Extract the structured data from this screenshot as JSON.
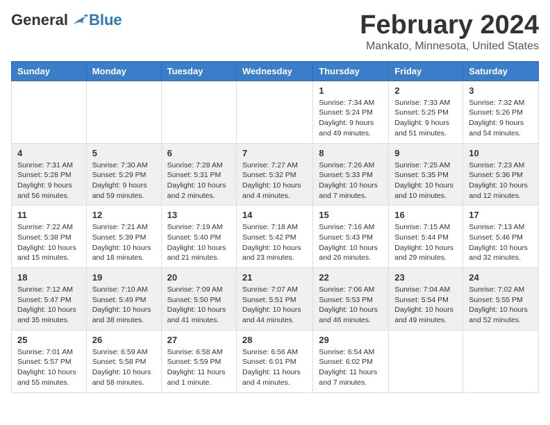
{
  "header": {
    "logo_general": "General",
    "logo_blue": "Blue",
    "month_title": "February 2024",
    "location": "Mankato, Minnesota, United States"
  },
  "weekdays": [
    "Sunday",
    "Monday",
    "Tuesday",
    "Wednesday",
    "Thursday",
    "Friday",
    "Saturday"
  ],
  "weeks": [
    [
      {
        "day": "",
        "info": ""
      },
      {
        "day": "",
        "info": ""
      },
      {
        "day": "",
        "info": ""
      },
      {
        "day": "",
        "info": ""
      },
      {
        "day": "1",
        "info": "Sunrise: 7:34 AM\nSunset: 5:24 PM\nDaylight: 9 hours\nand 49 minutes."
      },
      {
        "day": "2",
        "info": "Sunrise: 7:33 AM\nSunset: 5:25 PM\nDaylight: 9 hours\nand 51 minutes."
      },
      {
        "day": "3",
        "info": "Sunrise: 7:32 AM\nSunset: 5:26 PM\nDaylight: 9 hours\nand 54 minutes."
      }
    ],
    [
      {
        "day": "4",
        "info": "Sunrise: 7:31 AM\nSunset: 5:28 PM\nDaylight: 9 hours\nand 56 minutes."
      },
      {
        "day": "5",
        "info": "Sunrise: 7:30 AM\nSunset: 5:29 PM\nDaylight: 9 hours\nand 59 minutes."
      },
      {
        "day": "6",
        "info": "Sunrise: 7:28 AM\nSunset: 5:31 PM\nDaylight: 10 hours\nand 2 minutes."
      },
      {
        "day": "7",
        "info": "Sunrise: 7:27 AM\nSunset: 5:32 PM\nDaylight: 10 hours\nand 4 minutes."
      },
      {
        "day": "8",
        "info": "Sunrise: 7:26 AM\nSunset: 5:33 PM\nDaylight: 10 hours\nand 7 minutes."
      },
      {
        "day": "9",
        "info": "Sunrise: 7:25 AM\nSunset: 5:35 PM\nDaylight: 10 hours\nand 10 minutes."
      },
      {
        "day": "10",
        "info": "Sunrise: 7:23 AM\nSunset: 5:36 PM\nDaylight: 10 hours\nand 12 minutes."
      }
    ],
    [
      {
        "day": "11",
        "info": "Sunrise: 7:22 AM\nSunset: 5:38 PM\nDaylight: 10 hours\nand 15 minutes."
      },
      {
        "day": "12",
        "info": "Sunrise: 7:21 AM\nSunset: 5:39 PM\nDaylight: 10 hours\nand 18 minutes."
      },
      {
        "day": "13",
        "info": "Sunrise: 7:19 AM\nSunset: 5:40 PM\nDaylight: 10 hours\nand 21 minutes."
      },
      {
        "day": "14",
        "info": "Sunrise: 7:18 AM\nSunset: 5:42 PM\nDaylight: 10 hours\nand 23 minutes."
      },
      {
        "day": "15",
        "info": "Sunrise: 7:16 AM\nSunset: 5:43 PM\nDaylight: 10 hours\nand 26 minutes."
      },
      {
        "day": "16",
        "info": "Sunrise: 7:15 AM\nSunset: 5:44 PM\nDaylight: 10 hours\nand 29 minutes."
      },
      {
        "day": "17",
        "info": "Sunrise: 7:13 AM\nSunset: 5:46 PM\nDaylight: 10 hours\nand 32 minutes."
      }
    ],
    [
      {
        "day": "18",
        "info": "Sunrise: 7:12 AM\nSunset: 5:47 PM\nDaylight: 10 hours\nand 35 minutes."
      },
      {
        "day": "19",
        "info": "Sunrise: 7:10 AM\nSunset: 5:49 PM\nDaylight: 10 hours\nand 38 minutes."
      },
      {
        "day": "20",
        "info": "Sunrise: 7:09 AM\nSunset: 5:50 PM\nDaylight: 10 hours\nand 41 minutes."
      },
      {
        "day": "21",
        "info": "Sunrise: 7:07 AM\nSunset: 5:51 PM\nDaylight: 10 hours\nand 44 minutes."
      },
      {
        "day": "22",
        "info": "Sunrise: 7:06 AM\nSunset: 5:53 PM\nDaylight: 10 hours\nand 46 minutes."
      },
      {
        "day": "23",
        "info": "Sunrise: 7:04 AM\nSunset: 5:54 PM\nDaylight: 10 hours\nand 49 minutes."
      },
      {
        "day": "24",
        "info": "Sunrise: 7:02 AM\nSunset: 5:55 PM\nDaylight: 10 hours\nand 52 minutes."
      }
    ],
    [
      {
        "day": "25",
        "info": "Sunrise: 7:01 AM\nSunset: 5:57 PM\nDaylight: 10 hours\nand 55 minutes."
      },
      {
        "day": "26",
        "info": "Sunrise: 6:59 AM\nSunset: 5:58 PM\nDaylight: 10 hours\nand 58 minutes."
      },
      {
        "day": "27",
        "info": "Sunrise: 6:58 AM\nSunset: 5:59 PM\nDaylight: 11 hours\nand 1 minute."
      },
      {
        "day": "28",
        "info": "Sunrise: 6:56 AM\nSunset: 6:01 PM\nDaylight: 11 hours\nand 4 minutes."
      },
      {
        "day": "29",
        "info": "Sunrise: 6:54 AM\nSunset: 6:02 PM\nDaylight: 11 hours\nand 7 minutes."
      },
      {
        "day": "",
        "info": ""
      },
      {
        "day": "",
        "info": ""
      }
    ]
  ]
}
